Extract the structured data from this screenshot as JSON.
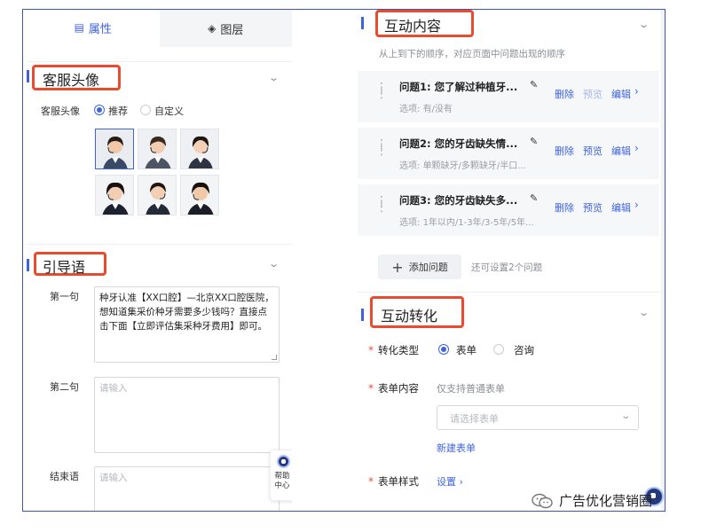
{
  "tabs": [
    {
      "label": "属性",
      "icon": "properties-icon",
      "active": true
    },
    {
      "label": "图层",
      "icon": "layers-icon",
      "active": false
    }
  ],
  "avatar_section": {
    "title": "客服头像",
    "field_label": "客服头像",
    "options": [
      {
        "label": "推荐",
        "selected": true
      },
      {
        "label": "自定义",
        "selected": false
      }
    ],
    "avatar_count": 6,
    "selected_index": 0
  },
  "guide_section": {
    "title": "引导语",
    "first_label": "第一句",
    "first_value": "种牙认准【XX口腔】—北京XX口腔医院，想知道集采价种牙需要多少钱吗？直接点击下面【立即评估集采种牙费用】即可。",
    "second_label": "第二句",
    "second_placeholder": "请输入",
    "end_label": "结束语",
    "end_placeholder": "请输入"
  },
  "help_widget": {
    "line1": "帮助",
    "line2": "中心"
  },
  "interaction_section": {
    "title": "互动内容",
    "subtitle": "从上到下的顺序，对应页面中问题出现的顺序",
    "options_prefix": "选项:",
    "questions": [
      {
        "title": "问题1: 您了解过种植牙...",
        "options": "有/没有",
        "actions": [
          "删除",
          "预览",
          "编辑"
        ],
        "preview_disabled": true
      },
      {
        "title": "问题2: 您的牙齿缺失情...",
        "options": "单颗缺牙/多颗缺牙/半口...",
        "actions": [
          "删除",
          "预览",
          "编辑"
        ],
        "preview_disabled": false
      },
      {
        "title": "问题3: 您的牙齿缺失多...",
        "options": "1年以内/1-3年/3-5年/5年...",
        "actions": [
          "删除",
          "预览",
          "编辑"
        ],
        "preview_disabled": false
      }
    ],
    "add_button": "添加问题",
    "add_hint": "还可设置2个问题"
  },
  "conversion_section": {
    "title": "互动转化",
    "type_label": "转化类型",
    "type_options": [
      {
        "label": "表单",
        "selected": true
      },
      {
        "label": "咨询",
        "selected": false
      }
    ],
    "form_label": "表单内容",
    "form_hint": "仅支持普通表单",
    "select_placeholder": "请选择表单",
    "new_form_link": "新建表单",
    "style_label": "表单样式",
    "style_link": "设置"
  },
  "watermark": "广告优化营销圈",
  "colors": {
    "accent": "#3e63dd",
    "highlight_box": "#e94b2f",
    "frame_border": "#3f56a8",
    "required": "#e34d3b"
  }
}
